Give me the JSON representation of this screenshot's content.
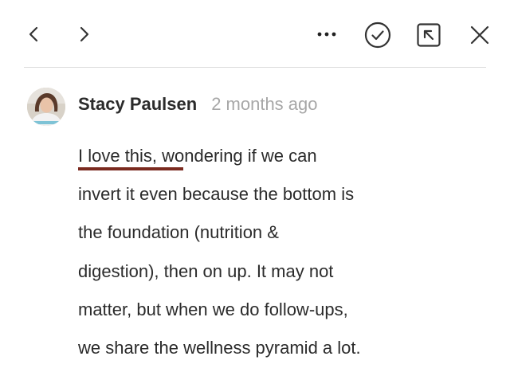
{
  "toolbar": {
    "prev_icon": "chevron-left-icon",
    "next_icon": "chevron-right-icon",
    "more_icon": "more-horizontal-icon",
    "resolve_icon": "check-circle-icon",
    "expand_icon": "open-in-panel-icon",
    "close_icon": "close-icon"
  },
  "comment": {
    "author": "Stacy Paulsen",
    "time": "2 months ago",
    "lines": [
      "I love this, wondering if we can",
      "invert it even because the bottom is",
      "the foundation (nutrition &",
      "digestion), then on up. It may not",
      "matter, but when we do follow-ups,",
      "we share the wellness pyramid a lot."
    ]
  },
  "colors": {
    "text": "#2b2b2b",
    "muted": "#a7a7a7",
    "highlight_underline": "#7a2a1f",
    "divider": "#dcdcdc"
  }
}
